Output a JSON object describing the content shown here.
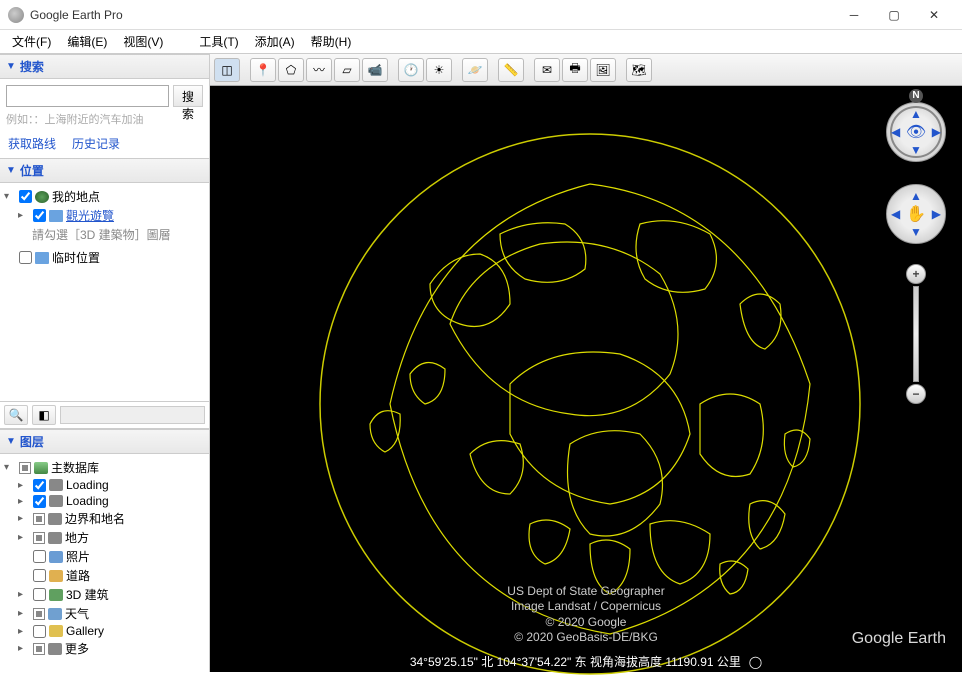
{
  "window": {
    "title": "Google Earth Pro"
  },
  "menu": {
    "file": "文件(F)",
    "edit": "编辑(E)",
    "view": "视图(V)",
    "tools": "工具(T)",
    "add": "添加(A)",
    "help": "帮助(H)"
  },
  "search": {
    "title": "搜索",
    "button": "搜索",
    "placeholder": "例如：：上海附近的汽车加油",
    "route": "获取路线",
    "history": "历史记录"
  },
  "places": {
    "title": "位置",
    "myplaces": "我的地点",
    "sightseeing": "觀光遊覽",
    "hint": "請勾選［3D 建築物］圖層",
    "temp": "临时位置"
  },
  "layers": {
    "title": "图层",
    "primary": "主数据库",
    "items": [
      {
        "label": "Loading",
        "checked": true,
        "exp": true,
        "color": "#888"
      },
      {
        "label": "Loading",
        "checked": true,
        "exp": true,
        "color": "#888"
      },
      {
        "label": "边界和地名",
        "checked": true,
        "mixed": true,
        "exp": true,
        "color": "#888"
      },
      {
        "label": "地方",
        "checked": true,
        "mixed": true,
        "exp": true,
        "color": "#888"
      },
      {
        "label": "照片",
        "checked": false,
        "exp": false,
        "color": "#6a9cd4"
      },
      {
        "label": "道路",
        "checked": false,
        "exp": false,
        "color": "#e0b050"
      },
      {
        "label": "3D 建筑",
        "checked": false,
        "exp": true,
        "color": "#60a060"
      },
      {
        "label": "天气",
        "checked": true,
        "mixed": true,
        "exp": true,
        "color": "#70a0d0"
      },
      {
        "label": "Gallery",
        "checked": false,
        "exp": true,
        "color": "#e0c050"
      },
      {
        "label": "更多",
        "checked": false,
        "exp": true,
        "mixed": true,
        "color": "#888"
      }
    ]
  },
  "attribution": {
    "l1": "US Dept of State Geographer",
    "l2": "Image Landsat / Copernicus",
    "l3": "© 2020 Google",
    "l4": "© 2020 GeoBasis-DE/BKG"
  },
  "status": "34°59'25.15\" 北  104°37'54.22\" 东  视角海拔高度 11190.91 公里",
  "brand": "Google Earth",
  "compass_n": "N"
}
